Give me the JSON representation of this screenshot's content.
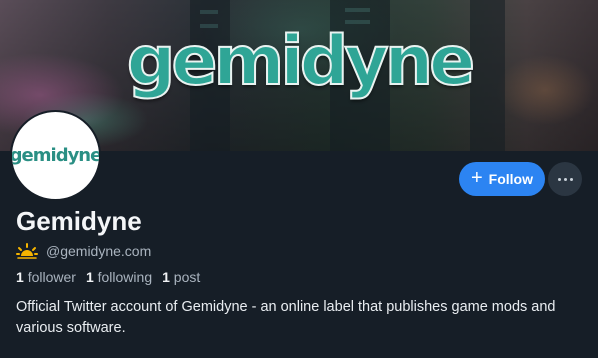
{
  "banner": {
    "logo_text": "gemidyne"
  },
  "avatar": {
    "logo_text": "gemidyne"
  },
  "actions": {
    "follow_label": "Follow",
    "more_icon": "ellipsis-icon"
  },
  "profile": {
    "display_name": "Gemidyne",
    "status_icon": "sunrise-icon",
    "handle": "@gemidyne.com",
    "stats": [
      {
        "count": "1",
        "label": "follower"
      },
      {
        "count": "1",
        "label": "following"
      },
      {
        "count": "1",
        "label": "post"
      }
    ],
    "bio": "Official Twitter account of Gemidyne - an online label that publishes game mods and various software."
  },
  "colors": {
    "accent": "#2c84f2",
    "background": "#161e27",
    "brand_teal": "#2fa596"
  }
}
